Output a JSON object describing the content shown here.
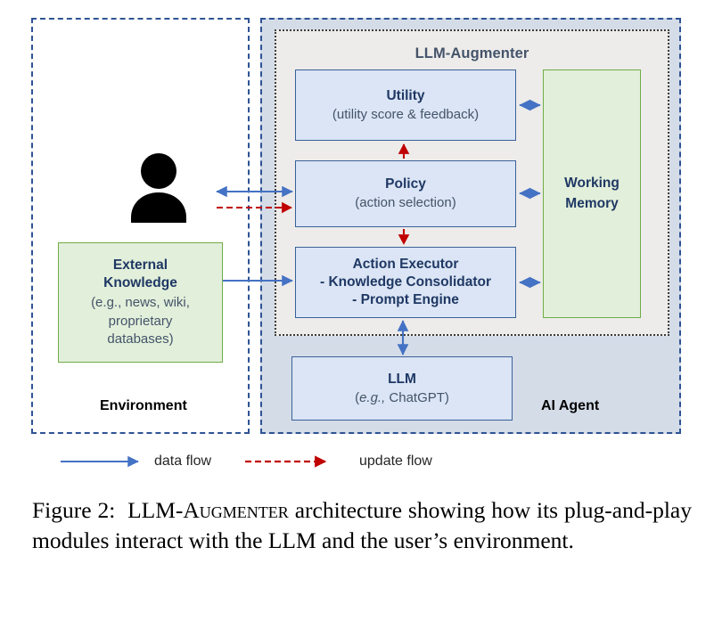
{
  "figure": {
    "environment": {
      "label": "Environment",
      "user_icon": "user-person-icon",
      "external_knowledge": {
        "title_line1": "External",
        "title_line2": "Knowledge",
        "sub_line1": "(e.g., news, wiki,",
        "sub_line2": "proprietary",
        "sub_line3": "databases)"
      }
    },
    "agent": {
      "label": "AI Agent",
      "augmenter_title": "LLM-Augmenter",
      "modules": {
        "utility": {
          "title": "Utility",
          "sub": "(utility score & feedback)"
        },
        "policy": {
          "title": "Policy",
          "sub": "(action selection)"
        },
        "action_executor": {
          "title": "Action Executor",
          "line2": "- Knowledge Consolidator",
          "line3": "- Prompt Engine"
        },
        "working_memory": {
          "title_line1": "Working",
          "title_line2": "Memory"
        },
        "llm": {
          "title": "LLM",
          "sub_italic": "e.g.,",
          "sub_rest": " ChatGPT)",
          "sub_open": "("
        }
      }
    },
    "legend": {
      "data_flow_label": "data flow",
      "update_flow_label": "update flow"
    },
    "caption": {
      "prefix": "Figure 2:",
      "term_prefix": "LLM-",
      "term_smallcaps": "Augmenter",
      "rest": " architecture showing how its plug-and-play modules interact with the LLM and the user’s environment."
    },
    "colors": {
      "data_flow_blue": "#4472c4",
      "update_flow_red": "#c00000",
      "box_blue_fill": "#dbe5f5",
      "box_blue_border": "#3a6099",
      "box_green_fill": "#e2efda",
      "box_green_border": "#70ad47",
      "agent_panel_fill": "#d4dce8",
      "augmenter_panel_fill": "#edecea",
      "dashed_border": "#2e5395",
      "heading_text": "#1f3864",
      "sub_text": "#44546a"
    }
  }
}
